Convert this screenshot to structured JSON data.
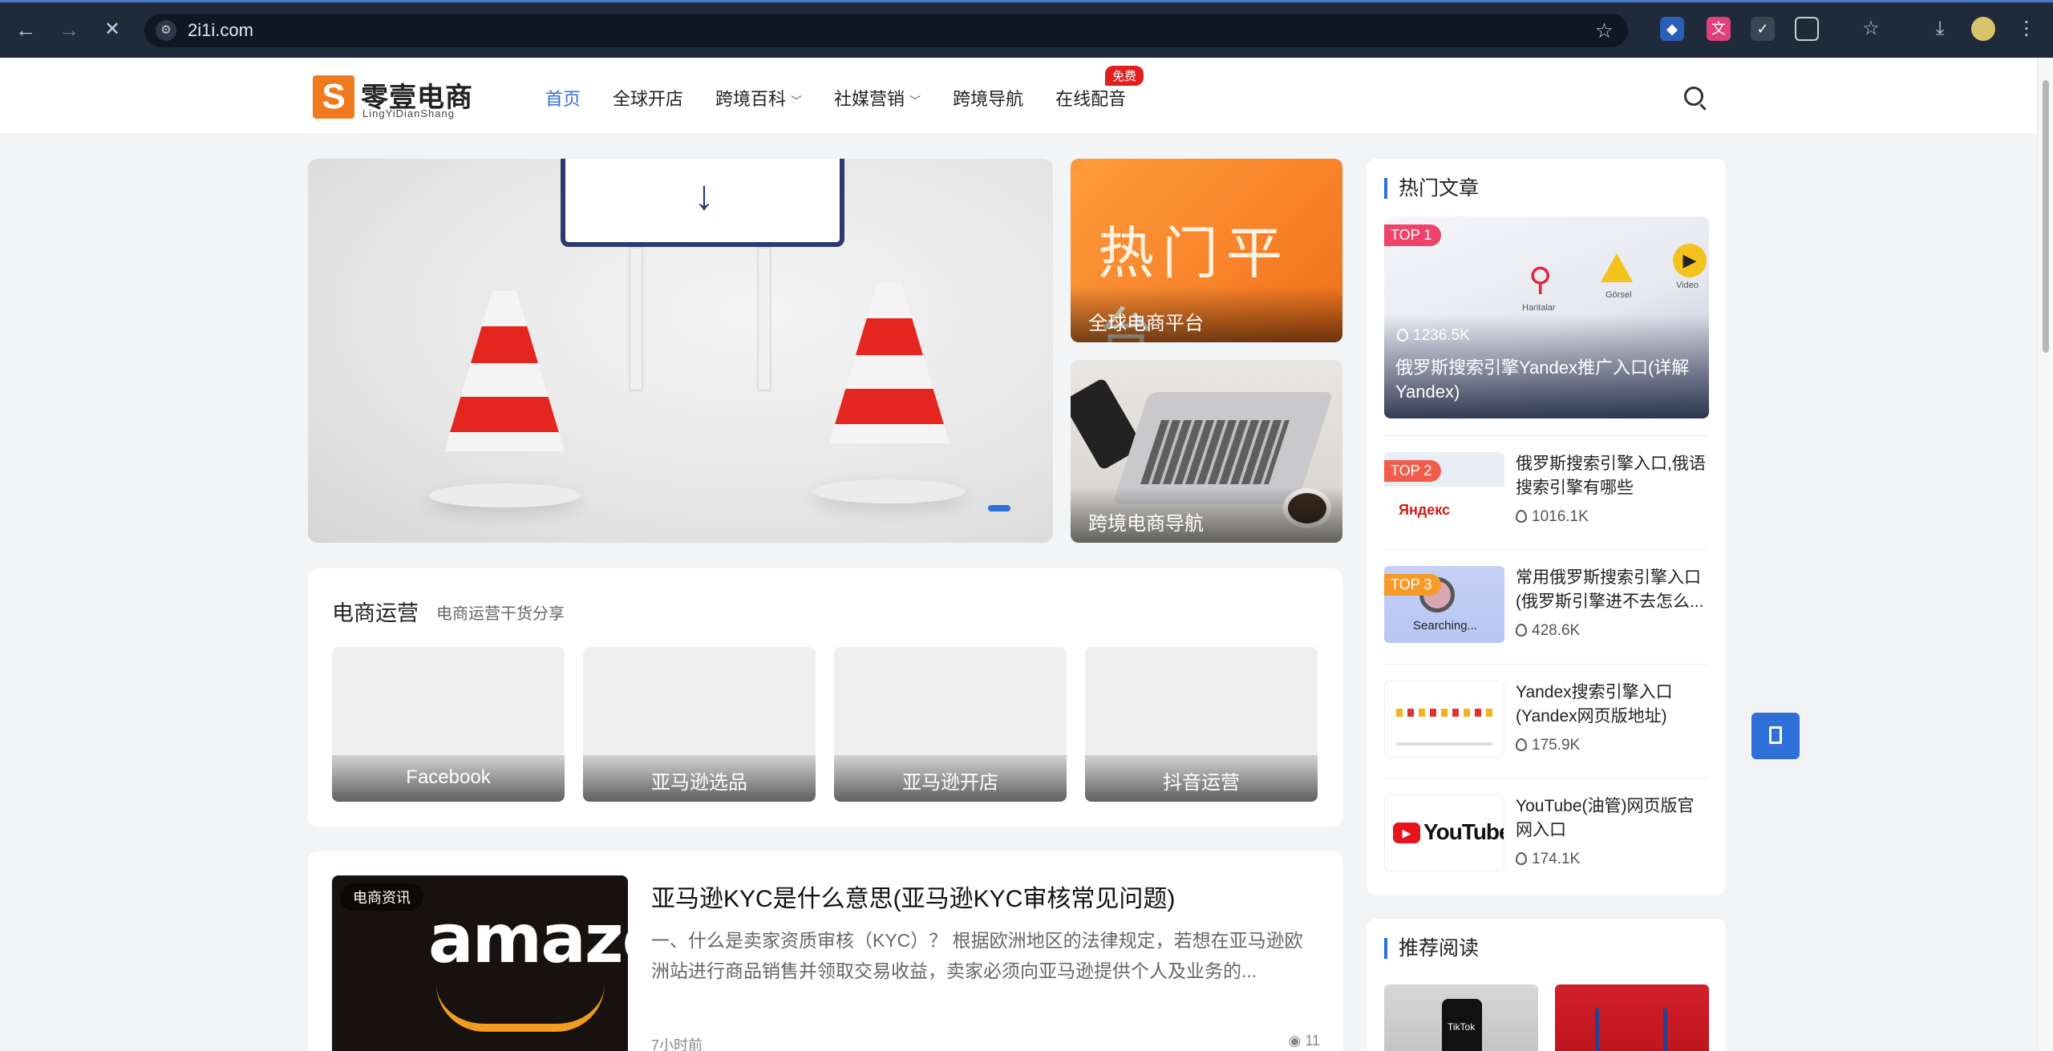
{
  "browser": {
    "url": "2i1i.com",
    "back_icon": "arrow-left-icon",
    "forward_icon": "arrow-right-icon",
    "reload_icon": "close-icon"
  },
  "site": {
    "logo_cn": "零壹电商",
    "logo_en": "LingYiDianShang",
    "logo_mark": "S"
  },
  "menu": {
    "items": [
      {
        "label": "首页"
      },
      {
        "label": "全球开店"
      },
      {
        "label": "跨境百科"
      },
      {
        "label": "社媒营销"
      },
      {
        "label": "跨境导航"
      },
      {
        "label": "在线配音"
      }
    ],
    "badge": "免费"
  },
  "hero": {
    "side_cards": [
      {
        "big_text": "热门平台",
        "label": "全球电商平台"
      },
      {
        "label": "跨境电商导航"
      }
    ]
  },
  "ops": {
    "title": "电商运营",
    "subtitle": "电商运营干货分享",
    "tiles": [
      "Facebook",
      "亚马逊选品",
      "亚马逊开店",
      "抖音运营"
    ]
  },
  "article": {
    "tag": "电商资讯",
    "thumb_text": "amazon",
    "title": "亚马逊KYC是什么意思(亚马逊KYC审核常见问题)",
    "excerpt": "一、什么是卖家资质审核（KYC）？ 根据欧洲地区的法律规定，若想在亚马逊欧洲站进行商品销售并领取交易收益，卖家必须向亚马逊提供个人及业务的...",
    "time": "7小时前",
    "views": "11"
  },
  "hot": {
    "title": "热门文章",
    "top1": {
      "badge": "TOP 1",
      "views": "1236.5K",
      "title": "俄罗斯搜索引擎Yandex推广入口(详解Yandex)",
      "thumb_labels": [
        "Haritalar",
        "Görsel",
        "Video"
      ]
    },
    "items": [
      {
        "badge": "TOP 2",
        "title": "俄罗斯搜索引擎入口,俄语搜索引擎有哪些",
        "views": "1016.1K",
        "thumb_text": "Яндекс"
      },
      {
        "badge": "TOP 3",
        "title": "常用俄罗斯搜索引擎入口(俄罗斯引擎进不去怎么...",
        "views": "428.6K",
        "thumb_text": "Searching..."
      },
      {
        "title": "Yandex搜索引擎入口(Yandex网页版地址)",
        "views": "175.9K"
      },
      {
        "title": "YouTube(油管)网页版官网入口",
        "views": "174.1K",
        "thumb_text": "YouTube"
      }
    ]
  },
  "recommend": {
    "title": "推荐阅读",
    "tiktok_text": "TikTok"
  },
  "colors": {
    "accent": "#2f6fd8",
    "logo_orange": "#f07a1e",
    "badge_red": "#e02020",
    "top1": "#f0436a",
    "top2": "#f25d4b",
    "top3": "#f69a2a"
  }
}
